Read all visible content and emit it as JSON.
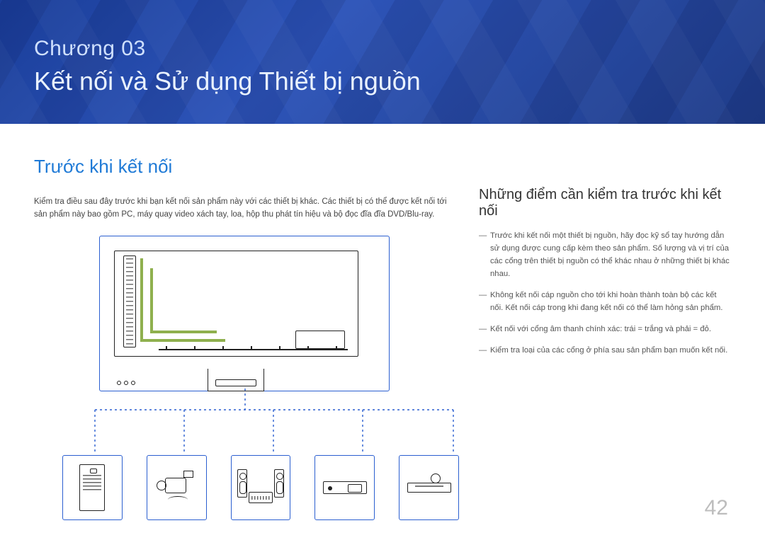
{
  "chapter": {
    "label": "Chương 03",
    "title": "Kết nối và Sử dụng Thiết bị nguồn"
  },
  "page_number": "42",
  "left": {
    "heading": "Trước khi kết nối",
    "body": "Kiểm tra điều sau đây trước khi bạn kết nối sản phẩm này với các thiết bị khác. Các thiết bị có thể được kết nối tới sản phẩm này bao gồm PC, máy quay video xách tay, loa, hộp thu phát tín hiệu và bộ đọc đĩa đĩa DVD/Blu-ray."
  },
  "right": {
    "heading": "Những điểm cần kiểm tra trước khi kết nối",
    "bullets": [
      "Trước khi kết nối một thiết bị nguồn, hãy đọc kỹ sổ tay hướng dẫn sử dụng được cung cấp kèm theo sản phẩm. Số lượng và vị trí của các cổng trên thiết bị nguồn có thể khác nhau ở những thiết bị khác nhau.",
      "Không kết nối cáp nguồn cho tới khi hoàn thành toàn bộ các kết nối. Kết nối cáp trong khi đang kết nối có thể làm hỏng sản phẩm.",
      "Kết nối với cổng âm thanh chính xác: trái = trắng và phải = đỏ.",
      "Kiểm tra loại của các cổng ở phía sau sản phẩm bạn muốn kết nối."
    ]
  },
  "diagram": {
    "main": "display-back-panel",
    "devices": [
      "pc-tower",
      "camcorder",
      "speaker-system",
      "set-top-box",
      "dvd-bluray-player"
    ]
  },
  "colors": {
    "accent": "#1f7ad6",
    "hero_dark": "#1a3e9a",
    "box_border": "#2b5fd0",
    "green": "#8fb04e"
  }
}
